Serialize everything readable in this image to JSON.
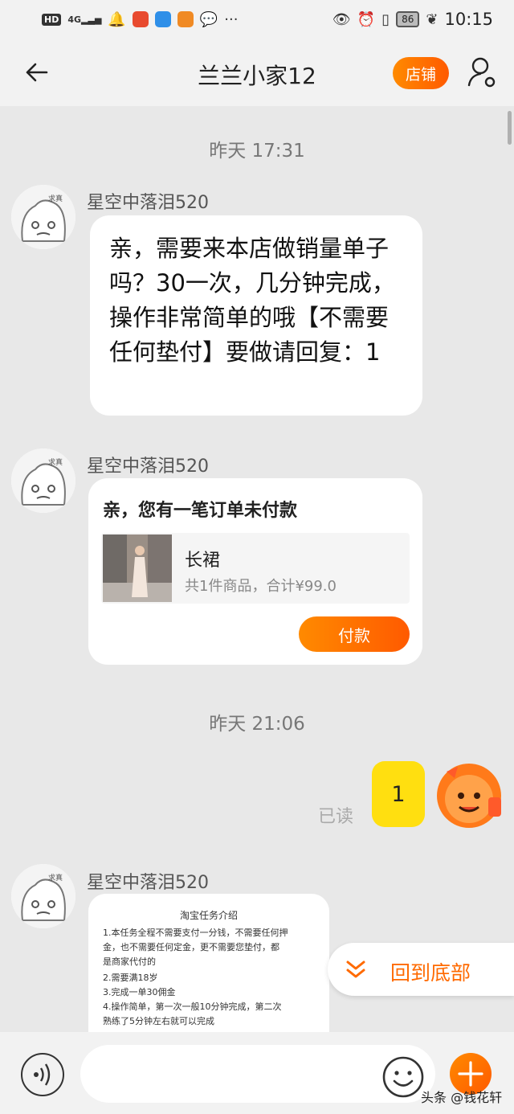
{
  "status_bar": {
    "net_label": "HD",
    "signal_label": "4G",
    "battery": "86",
    "time": "10:15"
  },
  "nav": {
    "title": "兰兰小家12",
    "shop_label": "店铺"
  },
  "messages": {
    "timestamp1": "昨天  17:31",
    "sender1": "星空中落泪520",
    "text1": "亲，需要来本店做销量单子吗？30一次，几分钟完成，操作非常简单的哦【不需要任何垫付】要做请回复：1",
    "sender2": "星空中落泪520",
    "order_title": "亲，您有一笔订单未付款",
    "order_name": "长裙",
    "order_summary": "共1件商品，合计¥99.0",
    "pay_label": "付款",
    "timestamp2": "昨天  21:06",
    "my_reply": "1",
    "read_label": "已读",
    "sender3": "星空中落泪520",
    "task": {
      "title": "淘宝任务介绍",
      "lines": [
        "1.本任务全程不需要支付一分钱，不需要任何押",
        "金，也不需要任何定金，更不需要您垫付，都",
        "是商家代付的",
        "2.需要满18岁",
        "3.完成一单30佣金",
        "4.操作简单，第一次一般10分钟完成，第二次",
        "熟练了5分钟左右就可以完成"
      ]
    }
  },
  "back_to_bottom_label": "回到底部",
  "input": {
    "placeholder": ""
  },
  "watermark": "头条 @钱花轩",
  "colors": {
    "accent": "#ff6a00",
    "my_bubble": "#ffdf10"
  }
}
